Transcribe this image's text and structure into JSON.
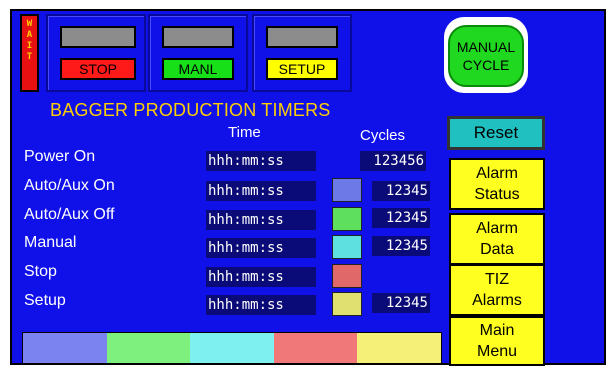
{
  "wait_indicator": {
    "letters": [
      "W",
      "A",
      "I",
      "T"
    ]
  },
  "mode_buttons": [
    {
      "label": "STOP",
      "color": "#ff1a1a"
    },
    {
      "label": "MANL",
      "color": "#18e018"
    },
    {
      "label": "SETUP",
      "color": "#ffff00"
    }
  ],
  "manual_cycle": {
    "line1": "MANUAL",
    "line2": "CYCLE"
  },
  "title": "BAGGER PRODUCTION TIMERS",
  "headers": {
    "time": "Time",
    "cycles": "Cycles"
  },
  "rows": [
    {
      "label": "Power On",
      "time": "hhh:mm:ss",
      "cycles": "123456",
      "swatch": null
    },
    {
      "label": "Auto/Aux On",
      "time": "hhh:mm:ss",
      "cycles": "12345",
      "swatch": "#6e79e8"
    },
    {
      "label": "Auto/Aux Off",
      "time": "hhh:mm:ss",
      "cycles": "12345",
      "swatch": "#5ee05e"
    },
    {
      "label": "Manual",
      "time": "hhh:mm:ss",
      "cycles": "12345",
      "swatch": "#5ee0e0"
    },
    {
      "label": "Stop",
      "time": "hhh:mm:ss",
      "cycles": "",
      "swatch": "#e06868"
    },
    {
      "label": "Setup",
      "time": "hhh:mm:ss",
      "cycles": "12345",
      "swatch": "#e0e070"
    }
  ],
  "reset_button": "Reset",
  "side_buttons": [
    {
      "line1": "Alarm",
      "line2": "Status"
    },
    {
      "line1": "Alarm",
      "line2": "Data"
    },
    {
      "line1": "TIZ",
      "line2": "Alarms"
    },
    {
      "line1": "Main",
      "line2": "Menu"
    }
  ],
  "legend_colors": [
    "#7b83f0",
    "#7ef07e",
    "#7ef0f0",
    "#f07878",
    "#f5f078"
  ]
}
